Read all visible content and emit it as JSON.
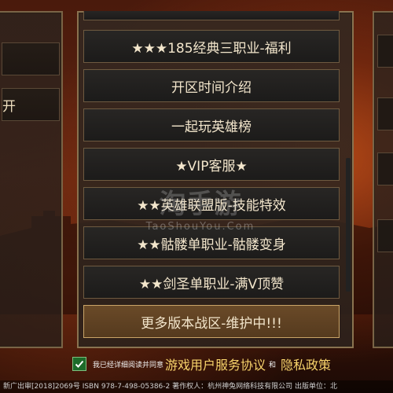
{
  "left_panel": {
    "item_text": "开"
  },
  "menu": {
    "items": [
      {
        "label": "★★★185经典三职业-福利"
      },
      {
        "label": "开区时间介绍"
      },
      {
        "label": "一起玩英雄榜"
      },
      {
        "label": "★VIP客服★"
      },
      {
        "label": "★★英雄联盟版-技能特效"
      },
      {
        "label": "★★骷髅单职业-骷髅变身"
      },
      {
        "label": "★★剑圣单职业-满V顶赞"
      },
      {
        "label": "更多版本战区-维护中!!!"
      }
    ]
  },
  "watermark": {
    "title": "淘手游",
    "subtitle": "TaoShouYou.Com"
  },
  "agreement": {
    "checked": true,
    "prefix": "我已经详细阅读并同意",
    "link1": "游戏用户服务协议",
    "and": "和",
    "link2": "隐私政策"
  },
  "footer": {
    "text": "新广出审[2018]2069号 ISBN 978-7-498-05386-2 著作权人：杭州神兔网络科技有限公司 出版单位：北"
  },
  "colors": {
    "accent": "#f7d36b",
    "highlight": "#6a4a28",
    "check": "#1d6b2a"
  }
}
